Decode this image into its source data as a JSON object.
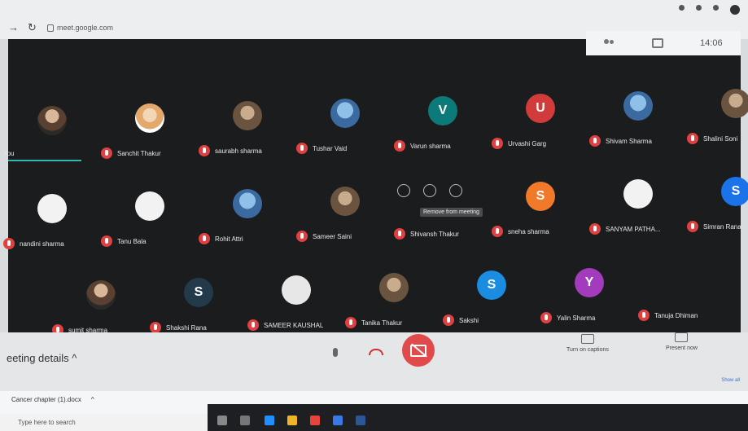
{
  "browser": {
    "url": "meet.google.com"
  },
  "top_panel": {
    "time": "14:06"
  },
  "participants": [
    {
      "name": "You",
      "avatar": "",
      "style": "photo"
    },
    {
      "name": "Sanchit Thakur",
      "avatar": "",
      "style": "photo2"
    },
    {
      "name": "saurabh sharma",
      "avatar": "",
      "style": "photo4"
    },
    {
      "name": "Tushar Vaid",
      "avatar": "",
      "style": "photo3"
    },
    {
      "name": "Varun sharma",
      "avatar": "V",
      "color": "#0d7a7a"
    },
    {
      "name": "Urvashi Garg",
      "avatar": "U",
      "color": "#d23b3b"
    },
    {
      "name": "Shivam Sharma",
      "avatar": "",
      "style": "photo3"
    },
    {
      "name": "Shalini Soni",
      "avatar": "",
      "style": "photo4"
    },
    {
      "name": "nandini sharma",
      "avatar": "",
      "style": "plain"
    },
    {
      "name": "Tanu Bala",
      "avatar": "",
      "style": "plain"
    },
    {
      "name": "Rohit Attri",
      "avatar": "",
      "style": "photo3"
    },
    {
      "name": "Sameer Saini",
      "avatar": "",
      "style": "photo4"
    },
    {
      "name": "Shivansh Thakur",
      "avatar": "",
      "style": "none"
    },
    {
      "name": "sneha sharma",
      "avatar": "S",
      "color": "#f07a2a"
    },
    {
      "name": "SANYAM PATHA...",
      "avatar": "",
      "style": "plain"
    },
    {
      "name": "Simran Rana",
      "avatar": "S",
      "color": "#1a73e8"
    },
    {
      "name": "sumit sharma",
      "avatar": "",
      "style": "photo"
    },
    {
      "name": "Shakshi Rana",
      "avatar": "S",
      "color": "#233a4a"
    },
    {
      "name": "SAMEER KAUSHAL",
      "avatar": "",
      "style": "plain-grey"
    },
    {
      "name": "Tanika Thakur",
      "avatar": "",
      "style": "photo4"
    },
    {
      "name": "Sakshi",
      "avatar": "S",
      "color": "#1a8de0"
    },
    {
      "name": "Yalin Sharma",
      "avatar": "Y",
      "color": "#a33bbd"
    },
    {
      "name": "Tanuja Dhiman",
      "avatar": "",
      "style": "none"
    }
  ],
  "tooltip": "Remove from meeting",
  "controls": {
    "meeting_details": "eeting details",
    "captions": "Turn on captions",
    "present": "Present now",
    "show_all": "Show all"
  },
  "downloads": {
    "file": "Cancer chapter (1).docx"
  },
  "taskbar": {
    "search_placeholder": "Type here to search"
  }
}
